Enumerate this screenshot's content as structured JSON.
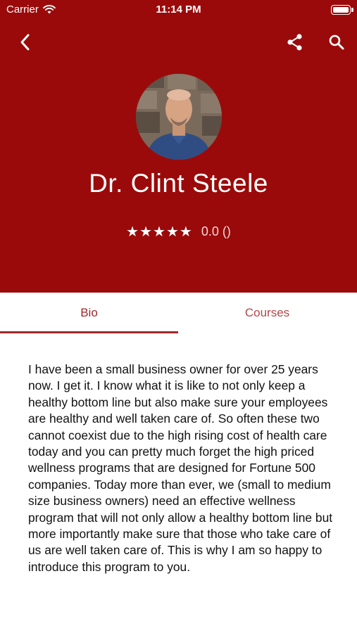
{
  "status_bar": {
    "carrier": "Carrier",
    "time": "11:14 PM"
  },
  "profile": {
    "name": "Dr. Clint Steele",
    "stars": "★★★★★",
    "rating_text": "0.0 ()"
  },
  "tabs": [
    {
      "label": "Bio",
      "selected": true
    },
    {
      "label": "Courses",
      "selected": false
    }
  ],
  "bio_text": "I have been a small business owner for over 25 years now. I get it. I know what it is like to not only keep a healthy bottom line but also make sure your employees are healthy and well taken care of. So often these two cannot coexist due to the high rising cost of health care today and you can pretty much forget the high priced wellness programs that are designed for Fortune 500 companies. Today more than ever, we (small to medium size business owners) need an effective wellness program that will not only allow a healthy bottom line but more importantly make sure that those who take care of us are well taken care of. This is why I am so happy to introduce this program to you.",
  "colors": {
    "header_bg": "#9b0a0a",
    "accent": "#a3262a"
  },
  "icons": [
    "chevron-left-icon",
    "share-icon",
    "search-icon",
    "wifi-icon",
    "battery-icon",
    "star-icon"
  ]
}
